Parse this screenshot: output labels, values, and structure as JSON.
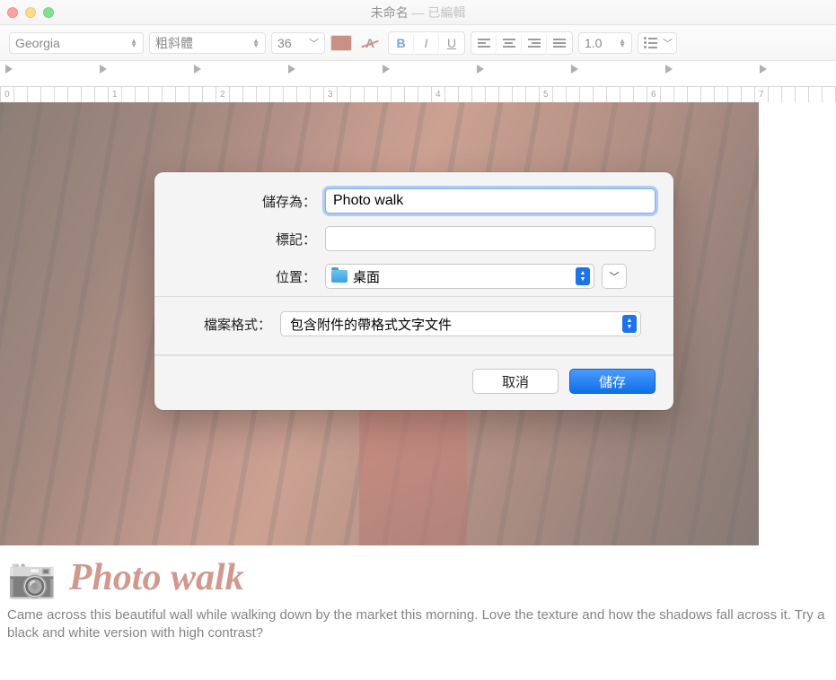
{
  "window": {
    "title_main": "未命名",
    "title_sep": " — ",
    "title_state": "已編輯"
  },
  "toolbar": {
    "font_family": "Georgia",
    "font_style": "粗斜體",
    "font_size": "36",
    "line_spacing": "1.0",
    "bold_glyph": "B",
    "italic_glyph": "I",
    "underline_glyph": "U",
    "color_swatch": "#a3432f",
    "strike_glyph": "A"
  },
  "ruler": {
    "numbers": [
      "0",
      "1",
      "2",
      "3",
      "4",
      "5",
      "6",
      "7"
    ]
  },
  "document": {
    "camera_emoji": "📷",
    "title": "Photo walk",
    "body": "Came across this beautiful wall while walking down by the market this morning. Love the texture and how the shadows fall across it. Try a black and white version with high contrast?"
  },
  "dialog": {
    "saveas_label": "儲存為：",
    "saveas_value": "Photo walk",
    "tags_label": "標記：",
    "tags_value": "",
    "location_label": "位置：",
    "location_value": "桌面",
    "format_label": "檔案格式：",
    "format_value": "包含附件的帶格式文字文件",
    "cancel": "取消",
    "save": "儲存"
  }
}
